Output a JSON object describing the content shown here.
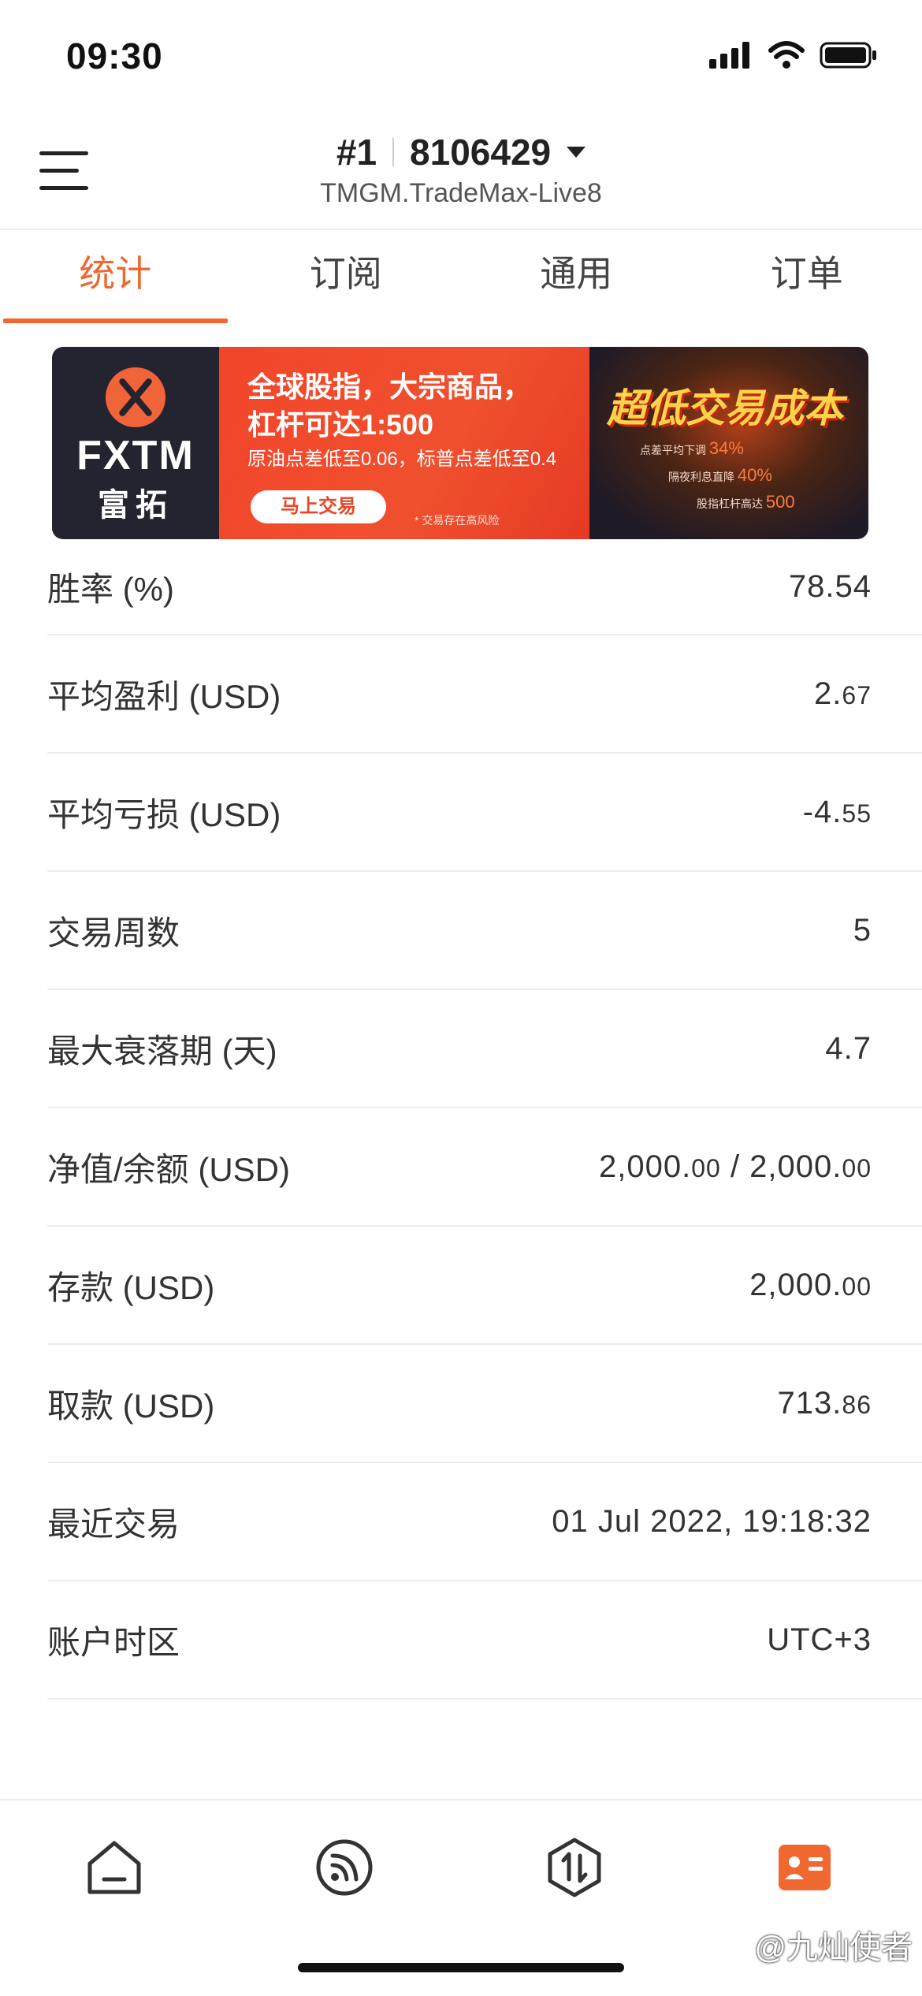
{
  "status_bar": {
    "time": "09:30"
  },
  "header": {
    "account_index": "#1",
    "account_number": "8106429",
    "server": "TMGM.TradeMax-Live8"
  },
  "tabs": [
    {
      "label": "统计",
      "active": true
    },
    {
      "label": "订阅",
      "active": false
    },
    {
      "label": "通用",
      "active": false
    },
    {
      "label": "订单",
      "active": false
    }
  ],
  "banner": {
    "brand": "FXTM",
    "brand_cn": "富拓",
    "headline1": "全球股指，大宗商品，",
    "headline2": "杠杆可达1:500",
    "subline": "原油点差低至0.06，标普点差低至0.4",
    "cta": "马上交易",
    "risk": "* 交易存在高风险",
    "promo_title": "超低交易成本",
    "promo_lines": [
      {
        "text": "点差平均下调",
        "value": "34%"
      },
      {
        "text": "隔夜利息直降",
        "value": "40%"
      },
      {
        "text": "股指杠杆高达",
        "value": "500"
      }
    ]
  },
  "stats": [
    {
      "label": "胜率 (%)",
      "value": "78.54"
    },
    {
      "label": "平均盈利 (USD)",
      "value_main": "2.",
      "value_small": "67"
    },
    {
      "label": "平均亏损 (USD)",
      "value_main": "-4.",
      "value_small": "55"
    },
    {
      "label": "交易周数",
      "value": "5"
    },
    {
      "label": "最大衰落期 (天)",
      "value": "4.7"
    },
    {
      "label": "净值/余额 (USD)",
      "value_main": "2,000.",
      "value_small": "00",
      "value_main2": " / 2,000.",
      "value_small2": "00"
    },
    {
      "label": "存款 (USD)",
      "value_main": "2,000.",
      "value_small": "00"
    },
    {
      "label": "取款 (USD)",
      "value_main": "713.",
      "value_small": "86"
    },
    {
      "label": "最近交易",
      "value": "01 Jul 2022, 19:18:32"
    },
    {
      "label": "账户时区",
      "value": "UTC+3"
    }
  ],
  "bottom_nav": [
    {
      "icon": "home-icon",
      "active": false
    },
    {
      "icon": "signal-feed-icon",
      "active": false
    },
    {
      "icon": "trade-arrows-icon",
      "active": false
    },
    {
      "icon": "profile-card-icon",
      "active": true
    }
  ],
  "watermark": "@九灿使者",
  "colors": {
    "accent": "#f0672f",
    "text": "#333333",
    "divider": "#ececec"
  }
}
